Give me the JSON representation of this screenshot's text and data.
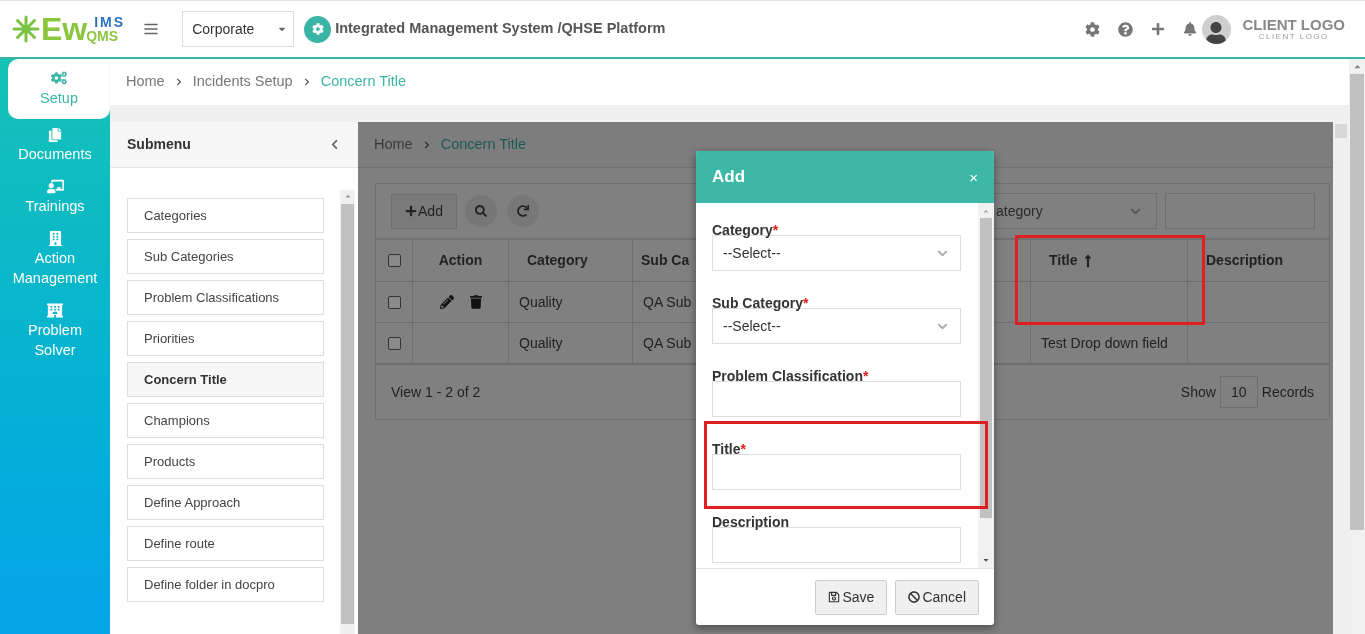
{
  "header": {
    "logo": {
      "main": "Ew",
      "top": "IMS",
      "bottom": "QMS"
    },
    "org_select": {
      "value": "Corporate"
    },
    "app_title": "Integrated Management System /QHSE Platform",
    "client_logo": {
      "main": "CLIENT LOGO",
      "sub": "CLIENT LOGO"
    }
  },
  "nav": [
    {
      "label": "Setup",
      "selected": true,
      "kind": "setup"
    },
    {
      "label": "Documents",
      "selected": false,
      "kind": "documents"
    },
    {
      "label": "Trainings",
      "selected": false,
      "kind": "trainings"
    },
    {
      "label": "Action Management",
      "selected": false,
      "kind": "actions"
    },
    {
      "label": "Problem Solver",
      "selected": false,
      "kind": "solver"
    }
  ],
  "breadcrumb": [
    "Home",
    "Incidents Setup",
    "Concern Title"
  ],
  "submenu": {
    "title": "Submenu",
    "items": [
      {
        "label": "Categories",
        "selected": false
      },
      {
        "label": "Sub Categories",
        "selected": false
      },
      {
        "label": "Problem Classifications",
        "selected": false
      },
      {
        "label": "Priorities",
        "selected": false
      },
      {
        "label": "Concern Title",
        "selected": true
      },
      {
        "label": "Champions",
        "selected": false
      },
      {
        "label": "Products",
        "selected": false
      },
      {
        "label": "Define Approach",
        "selected": false
      },
      {
        "label": "Define route",
        "selected": false
      },
      {
        "label": "Define folder in docpro",
        "selected": false
      }
    ]
  },
  "page": {
    "breadcrumb": [
      "Home",
      "Concern Title"
    ],
    "toolbar": {
      "add_label": "Add",
      "filter_value": "ategory"
    },
    "table": {
      "all_checked": false,
      "columns": [
        {
          "label": "Action",
          "sorted": false,
          "highlighted": false
        },
        {
          "label": "Category",
          "sorted": false,
          "highlighted": false
        },
        {
          "label": "Sub Ca",
          "sorted": false,
          "highlighted": false
        },
        {
          "label": "Title",
          "sorted": true,
          "highlighted": true
        },
        {
          "label": "Description",
          "sorted": false,
          "highlighted": false
        }
      ],
      "rows": [
        {
          "checked": false,
          "has_actions": true,
          "category": "Quality",
          "sub_category": "QA Sub"
        },
        {
          "checked": false,
          "has_actions": false,
          "category": "Quality",
          "sub_category": "QA Sub",
          "title": "Test Drop down field"
        }
      ]
    },
    "footer": {
      "summary": "View 1 - 2 of 2",
      "show_label": "Show",
      "page_size": "10",
      "records_label": "Records"
    }
  },
  "modal": {
    "title": "Add",
    "close": "×",
    "fields": [
      {
        "label": "Category",
        "required_mark": "*",
        "kind": "select",
        "value": "--Select--",
        "highlighted": false
      },
      {
        "label": "Sub Category",
        "required_mark": "*",
        "kind": "select",
        "value": "--Select--",
        "highlighted": false
      },
      {
        "label": "Problem Classification",
        "required_mark": "*",
        "kind": "input",
        "highlighted": false
      },
      {
        "label": "Title",
        "required_mark": "*",
        "kind": "input",
        "highlighted": true
      },
      {
        "label": "Description",
        "kind": "input",
        "highlighted": false
      }
    ],
    "buttons": [
      {
        "label": "Save",
        "kind": "save"
      },
      {
        "label": "Cancel",
        "kind": "cancel"
      }
    ]
  }
}
